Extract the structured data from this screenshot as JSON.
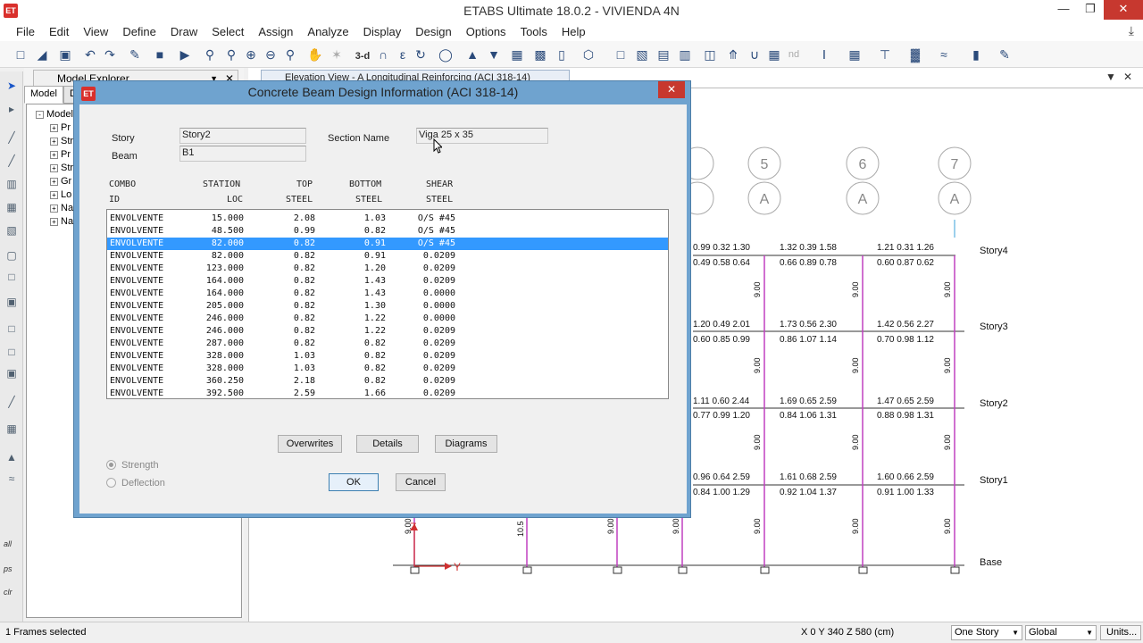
{
  "window": {
    "title": "ETABS Ultimate 18.0.2 - VIVIENDA 4N",
    "app_icon": "ET"
  },
  "menu": [
    "File",
    "Edit",
    "View",
    "Define",
    "Draw",
    "Select",
    "Assign",
    "Analyze",
    "Display",
    "Design",
    "Options",
    "Tools",
    "Help"
  ],
  "toolbar": {
    "view_3d_label": "3-d",
    "nd_label": "nd"
  },
  "left_toolbar": {
    "labels": [
      "all",
      "ps",
      "clr"
    ]
  },
  "explorer": {
    "title": "Model Explorer",
    "tabs": [
      "Model",
      "Di"
    ],
    "root": "Model",
    "items": [
      "Pr",
      "Str",
      "Pr",
      "Str",
      "Gr",
      "Lo",
      "Na",
      "Na"
    ]
  },
  "document": {
    "tab_title": "Elevation View - A  Longitudinal Reinforcing  (ACI 318-14)"
  },
  "elevation": {
    "axes": [
      {
        "num": "5",
        "letter": "A"
      },
      {
        "num": "6",
        "letter": "A"
      },
      {
        "num": "7",
        "letter": "A"
      }
    ],
    "stories": [
      "Story4",
      "Story3",
      "Story2",
      "Story1",
      "Base"
    ],
    "beam_values": [
      [
        "0.99 0.32 1.30",
        "1.32  0.39  1.58",
        "1.21  0.31  1.26"
      ],
      [
        "0.49 0.58 0.64",
        "0.66  0.89  0.78",
        "0.60  0.87  0.62"
      ],
      [
        "1.20 0.49 2.01",
        "1.73  0.56  2.30",
        "1.42  0.56  2.27"
      ],
      [
        "0.60 0.85 0.99",
        "0.86  1.07  1.14",
        "0.70  0.98  1.12"
      ],
      [
        "1.11 0.60 2.44",
        "1.69  0.65  2.59",
        "1.47  0.65  2.59"
      ],
      [
        "0.77 0.99 1.20",
        "0.84  1.06  1.31",
        "0.88  0.98  1.31"
      ],
      [
        "0.96 0.64 2.59",
        "1.61  0.68  2.59",
        "1.60  0.66  2.59"
      ],
      [
        "0.84 1.00 1.29",
        "0.92  1.04  1.37",
        "0.91  1.00  1.33"
      ]
    ],
    "column_value": "9.00",
    "column_value_alt": "10.5",
    "axis_z": "Z",
    "axis_y": "Y"
  },
  "dialog": {
    "title": "Concrete Beam Design Information (ACI 318-14)",
    "story_label": "Story",
    "story_value": "Story2",
    "beam_label": "Beam",
    "beam_value": "B1",
    "section_label": "Section Name",
    "section_value": "Viga 25 x 35",
    "headers": {
      "combo": [
        "COMBO",
        "ID"
      ],
      "station": [
        "STATION",
        "LOC"
      ],
      "top": [
        "TOP",
        "STEEL"
      ],
      "bottom": [
        "BOTTOM",
        "STEEL"
      ],
      "shear": [
        "SHEAR",
        "STEEL"
      ]
    },
    "rows": [
      [
        "ENVOLVENTE",
        "15.000",
        "2.08",
        "1.03",
        "O/S #45"
      ],
      [
        "ENVOLVENTE",
        "48.500",
        "0.99",
        "0.82",
        "O/S #45"
      ],
      [
        "ENVOLVENTE",
        "82.000",
        "0.82",
        "0.91",
        "O/S #45"
      ],
      [
        "ENVOLVENTE",
        "82.000",
        "0.82",
        "0.91",
        "0.0209"
      ],
      [
        "ENVOLVENTE",
        "123.000",
        "0.82",
        "1.20",
        "0.0209"
      ],
      [
        "ENVOLVENTE",
        "164.000",
        "0.82",
        "1.43",
        "0.0209"
      ],
      [
        "ENVOLVENTE",
        "164.000",
        "0.82",
        "1.43",
        "0.0000"
      ],
      [
        "ENVOLVENTE",
        "205.000",
        "0.82",
        "1.30",
        "0.0000"
      ],
      [
        "ENVOLVENTE",
        "246.000",
        "0.82",
        "1.22",
        "0.0000"
      ],
      [
        "ENVOLVENTE",
        "246.000",
        "0.82",
        "1.22",
        "0.0209"
      ],
      [
        "ENVOLVENTE",
        "287.000",
        "0.82",
        "0.82",
        "0.0209"
      ],
      [
        "ENVOLVENTE",
        "328.000",
        "1.03",
        "0.82",
        "0.0209"
      ],
      [
        "ENVOLVENTE",
        "328.000",
        "1.03",
        "0.82",
        "0.0209"
      ],
      [
        "ENVOLVENTE",
        "360.250",
        "2.18",
        "0.82",
        "0.0209"
      ],
      [
        "ENVOLVENTE",
        "392.500",
        "2.59",
        "1.66",
        "0.0209"
      ]
    ],
    "selected_row": 2,
    "buttons": {
      "overwrites": "Overwrites",
      "details": "Details",
      "diagrams": "Diagrams",
      "ok": "OK",
      "cancel": "Cancel"
    },
    "options": {
      "strength": "Strength",
      "deflection": "Deflection",
      "selected": "strength"
    }
  },
  "status": {
    "left": "1 Frames selected",
    "coords": "X 0  Y 340  Z 580 (cm)",
    "story_combo": "One Story",
    "coord_combo": "Global",
    "units": "Units..."
  },
  "colors": {
    "dialog_frame": "#6fa3cf",
    "selection": "#3399ff",
    "column": "#c040c0",
    "close_red": "#c7382f"
  }
}
